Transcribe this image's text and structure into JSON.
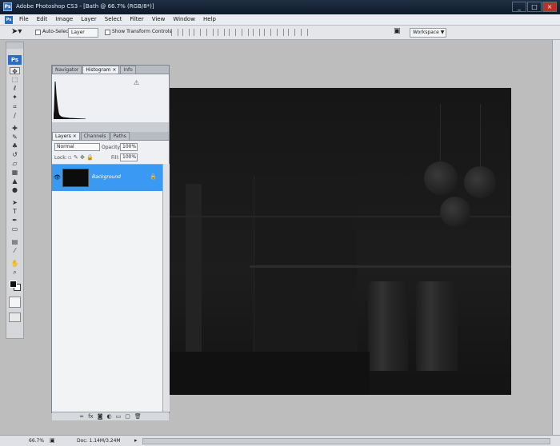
{
  "window": {
    "title": "Adobe Photoshop CS3 - [Bath @ 66.7% (RGB/8*)]",
    "app_icon": "Ps",
    "controls": [
      "_",
      "□",
      "×"
    ]
  },
  "menubar": {
    "items": [
      "File",
      "Edit",
      "Image",
      "Layer",
      "Select",
      "Filter",
      "View",
      "Window",
      "Help"
    ]
  },
  "optionsbar": {
    "auto_select_label": "Auto-Select",
    "auto_select_value": "Layer",
    "show_transform_label": "Show Transform Controls",
    "workspace_label": "Workspace ▼"
  },
  "toolbox": {
    "logo": "Ps",
    "tools": [
      "move",
      "marquee",
      "lasso",
      "magic-wand",
      "crop",
      "slice",
      "healing",
      "brush",
      "stamp",
      "history-brush",
      "eraser",
      "gradient",
      "blur",
      "dodge",
      "path-select",
      "type",
      "pen",
      "shape",
      "notes",
      "eyedropper",
      "hand",
      "zoom"
    ]
  },
  "panels": {
    "top_tabs": [
      "Navigator",
      "Histogram ×",
      "Info"
    ],
    "histogram_warning": "⚠",
    "layers_tabs": [
      "Layers ×",
      "Channels",
      "Paths"
    ],
    "blend_mode": "Normal",
    "opacity_label": "Opacity:",
    "opacity_value": "100%",
    "lock_label": "Lock:",
    "fill_label": "Fill:",
    "fill_value": "100%",
    "layer_name": "Background",
    "footer_icons": [
      "link",
      "fx",
      "mask",
      "adjustment",
      "group",
      "new-layer",
      "trash"
    ]
  },
  "status": {
    "zoom": "66.7%",
    "doc_info": "Doc: 1.14M/3.24M"
  }
}
